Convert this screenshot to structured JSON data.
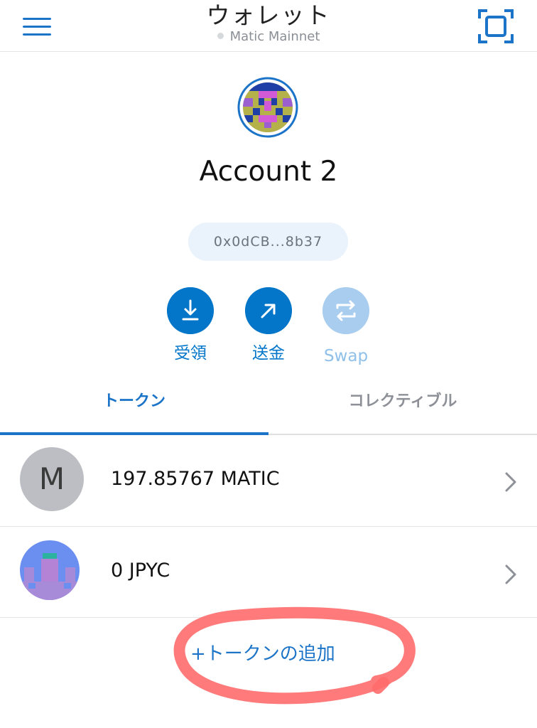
{
  "header": {
    "title": "ウォレット",
    "network": "Matic Mainnet",
    "menu_icon": "hamburger-menu-icon",
    "scan_icon": "qr-scan-icon"
  },
  "account": {
    "name": "Account 2",
    "address": "0x0dCB...8b37"
  },
  "actions": [
    {
      "label": "受領",
      "icon": "receive-download-icon",
      "enabled": true
    },
    {
      "label": "送金",
      "icon": "send-arrow-icon",
      "enabled": true
    },
    {
      "label": "Swap",
      "icon": "swap-arrows-icon",
      "enabled": false
    }
  ],
  "tabs": [
    {
      "label": "トークン",
      "active": true
    },
    {
      "label": "コレクティブル",
      "active": false
    }
  ],
  "tokens": [
    {
      "icon_text": "M",
      "balance": "197.85767 MATIC"
    },
    {
      "icon_text": "",
      "balance": "0 JPYC"
    }
  ],
  "add_token": {
    "label": "+トークンの追加"
  },
  "colors": {
    "accent": "#0376c9",
    "tab_accent": "#1b74c7",
    "swap_disabled": "#a8cdef",
    "pill_bg": "#eaf2fc",
    "annotation": "#ff6b6b"
  }
}
